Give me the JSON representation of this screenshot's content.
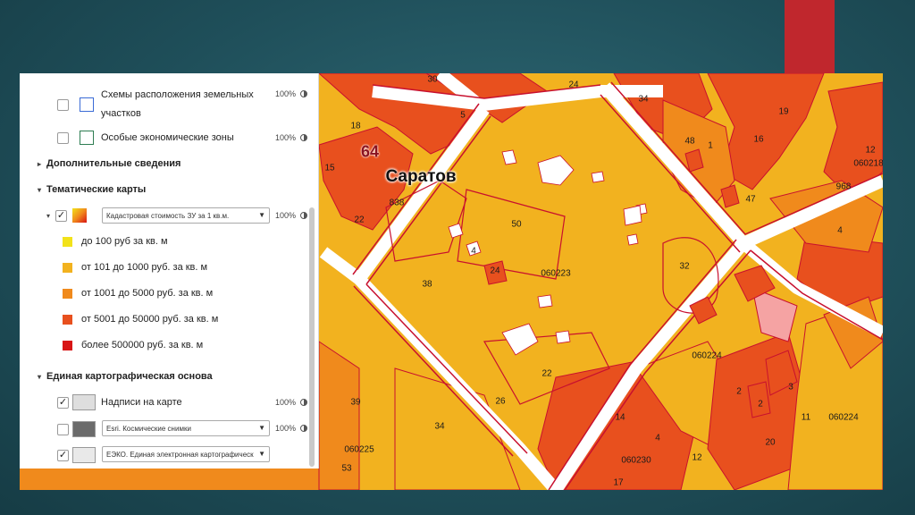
{
  "map": {
    "city_number": "64",
    "city_name": "Саратов",
    "labels": [
      {
        "id": "30",
        "text": "30"
      },
      {
        "id": "5a",
        "text": "5"
      },
      {
        "id": "24",
        "text": "24"
      },
      {
        "id": "34a",
        "text": "34"
      },
      {
        "id": "19",
        "text": "19"
      },
      {
        "id": "12",
        "text": "12"
      },
      {
        "id": "q060218",
        "text": "060218"
      },
      {
        "id": "18",
        "text": "18"
      },
      {
        "id": "48",
        "text": "48"
      },
      {
        "id": "1",
        "text": "1"
      },
      {
        "id": "16",
        "text": "16"
      },
      {
        "id": "15",
        "text": "15"
      },
      {
        "id": "968",
        "text": "968"
      },
      {
        "id": "4a",
        "text": "4"
      },
      {
        "id": "47",
        "text": "47"
      },
      {
        "id": "838",
        "text": "838"
      },
      {
        "id": "22a",
        "text": "22"
      },
      {
        "id": "50",
        "text": "50"
      },
      {
        "id": "q060223",
        "text": "060223"
      },
      {
        "id": "38",
        "text": "38"
      },
      {
        "id": "32",
        "text": "32"
      },
      {
        "id": "4b",
        "text": "4"
      },
      {
        "id": "24b",
        "text": "24"
      },
      {
        "id": "22b",
        "text": "22"
      },
      {
        "id": "26",
        "text": "26"
      },
      {
        "id": "q060224a",
        "text": "060224"
      },
      {
        "id": "q060224b",
        "text": "060224"
      },
      {
        "id": "39",
        "text": "39"
      },
      {
        "id": "34b",
        "text": "34"
      },
      {
        "id": "q060225",
        "text": "060225"
      },
      {
        "id": "53",
        "text": "53"
      },
      {
        "id": "14",
        "text": "14"
      },
      {
        "id": "4c",
        "text": "4"
      },
      {
        "id": "q060230",
        "text": "060230"
      },
      {
        "id": "12b",
        "text": "12"
      },
      {
        "id": "17",
        "text": "17"
      },
      {
        "id": "11",
        "text": "11"
      },
      {
        "id": "2a",
        "text": "2"
      },
      {
        "id": "2b",
        "text": "2"
      },
      {
        "id": "3",
        "text": "3"
      },
      {
        "id": "20",
        "text": "20"
      }
    ]
  },
  "panel": {
    "layer_scheme": {
      "label_line1": "Схемы расположения земельных",
      "label_line2": "участков",
      "opacity": "100%"
    },
    "layer_ecozones": {
      "label": "Особые экономические зоны",
      "opacity": "100%"
    },
    "section_extra": "Дополнительные сведения",
    "section_thematic": "Тематические карты",
    "thematic_layer": {
      "select": "Кадастровая стоимость ЗУ за 1 кв.м.",
      "opacity": "100%"
    },
    "legend": [
      {
        "label": "до 100 руб за кв. м",
        "color": "#f2e21a"
      },
      {
        "label": "от 101 до 1000 руб. за кв. м",
        "color": "#f2b21f"
      },
      {
        "label": "от 1001 до 5000 руб. за кв. м",
        "color": "#f08a1c"
      },
      {
        "label": "от 5001 до 50000 руб. за кв. м",
        "color": "#e8501e"
      },
      {
        "label": "более 500000 руб. за кв. м",
        "color": "#d81515"
      }
    ],
    "section_base": "Единая картографическая основа",
    "base_labels": {
      "label": "Надписи на карте",
      "opacity": "100%"
    },
    "base_esri": {
      "select": "Esri. Космические снимки",
      "opacity": "100%"
    },
    "base_eeko": {
      "select": "ЕЭКО. Единая электронная картографическ"
    }
  },
  "colors": {
    "accent": "#c0272d",
    "parcel_border": "#c8102e",
    "street": "#ffffff"
  }
}
